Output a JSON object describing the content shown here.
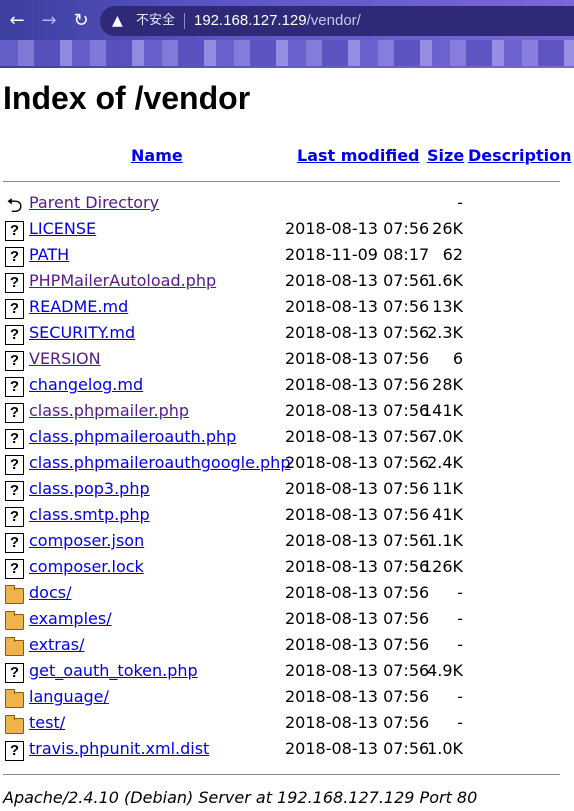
{
  "browser": {
    "security_text": "不安全",
    "url_host": "192.168.127.129",
    "url_path": "/vendor/"
  },
  "page": {
    "title": "Index of /vendor",
    "columns": {
      "name": "Name",
      "modified": "Last modified",
      "size": "Size",
      "description": "Description"
    },
    "footer": "Apache/2.4.10 (Debian) Server at 192.168.127.129 Port 80"
  },
  "entries": [
    {
      "name": "Parent Directory",
      "date": "",
      "size": "-",
      "icon": "back-icon",
      "visited": true
    },
    {
      "name": "LICENSE",
      "date": "2018-08-13 07:56",
      "size": "26K",
      "icon": "file-icon",
      "visited": false
    },
    {
      "name": "PATH",
      "date": "2018-11-09 08:17",
      "size": "62",
      "icon": "file-icon",
      "visited": false
    },
    {
      "name": "PHPMailerAutoload.php",
      "date": "2018-08-13 07:56",
      "size": "1.6K",
      "icon": "file-icon",
      "visited": true
    },
    {
      "name": "README.md",
      "date": "2018-08-13 07:56",
      "size": "13K",
      "icon": "file-icon",
      "visited": false
    },
    {
      "name": "SECURITY.md",
      "date": "2018-08-13 07:56",
      "size": "2.3K",
      "icon": "file-icon",
      "visited": false
    },
    {
      "name": "VERSION",
      "date": "2018-08-13 07:56",
      "size": "6",
      "icon": "file-icon",
      "visited": true
    },
    {
      "name": "changelog.md",
      "date": "2018-08-13 07:56",
      "size": "28K",
      "icon": "file-icon",
      "visited": false
    },
    {
      "name": "class.phpmailer.php",
      "date": "2018-08-13 07:56",
      "size": "141K",
      "icon": "file-icon",
      "visited": true
    },
    {
      "name": "class.phpmaileroauth.php",
      "date": "2018-08-13 07:56",
      "size": "7.0K",
      "icon": "file-icon",
      "visited": false
    },
    {
      "name": "class.phpmaileroauthgoogle.php",
      "date": "2018-08-13 07:56",
      "size": "2.4K",
      "icon": "file-icon",
      "visited": false
    },
    {
      "name": "class.pop3.php",
      "date": "2018-08-13 07:56",
      "size": "11K",
      "icon": "file-icon",
      "visited": false
    },
    {
      "name": "class.smtp.php",
      "date": "2018-08-13 07:56",
      "size": "41K",
      "icon": "file-icon",
      "visited": false
    },
    {
      "name": "composer.json",
      "date": "2018-08-13 07:56",
      "size": "1.1K",
      "icon": "file-icon",
      "visited": false
    },
    {
      "name": "composer.lock",
      "date": "2018-08-13 07:56",
      "size": "126K",
      "icon": "file-icon",
      "visited": false
    },
    {
      "name": "docs/",
      "date": "2018-08-13 07:56",
      "size": "-",
      "icon": "folder-icon",
      "visited": false
    },
    {
      "name": "examples/",
      "date": "2018-08-13 07:56",
      "size": "-",
      "icon": "folder-icon",
      "visited": false
    },
    {
      "name": "extras/",
      "date": "2018-08-13 07:56",
      "size": "-",
      "icon": "folder-icon",
      "visited": false
    },
    {
      "name": "get_oauth_token.php",
      "date": "2018-08-13 07:56",
      "size": "4.9K",
      "icon": "file-icon",
      "visited": false
    },
    {
      "name": "language/",
      "date": "2018-08-13 07:56",
      "size": "-",
      "icon": "folder-icon",
      "visited": false
    },
    {
      "name": "test/",
      "date": "2018-08-13 07:56",
      "size": "-",
      "icon": "folder-icon",
      "visited": false
    },
    {
      "name": "travis.phpunit.xml.dist",
      "date": "2018-08-13 07:56",
      "size": "1.0K",
      "icon": "file-icon",
      "visited": false
    }
  ]
}
